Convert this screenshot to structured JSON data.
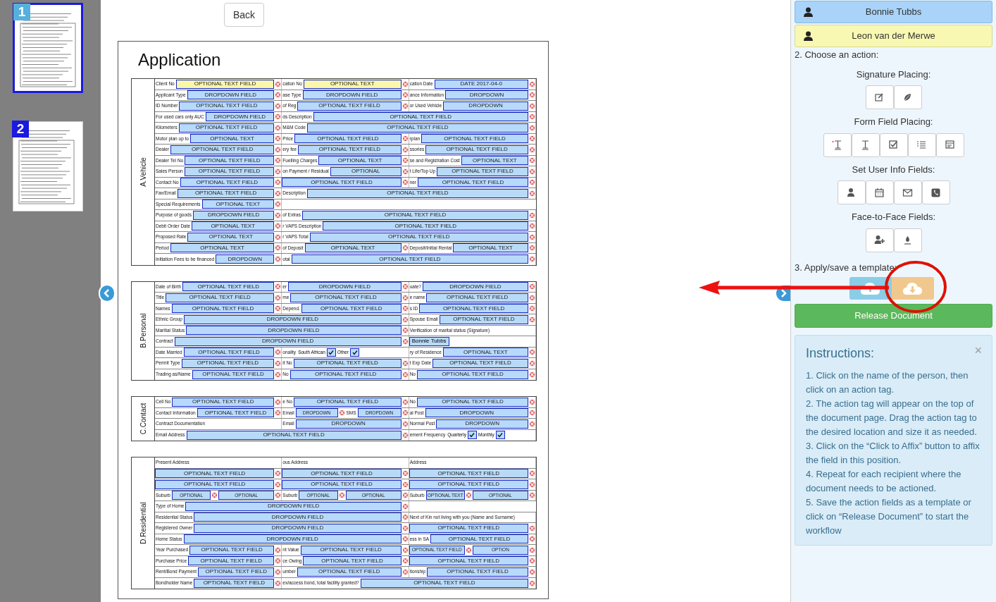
{
  "pages": [
    {
      "number": "1",
      "selected": true
    },
    {
      "number": "2",
      "selected": false
    }
  ],
  "back_button": "Back",
  "document": {
    "title": "Application",
    "sections": [
      {
        "title": "A.Vehicle",
        "rows": [
          [
            {
              "kind": "field",
              "label": "Client No",
              "field": "OPTIONAL TEXT FIELD",
              "required": true
            },
            {
              "kind": "field",
              "label": "cation No",
              "field": "OPTIONAL TEXT",
              "required": true
            },
            {
              "kind": "field",
              "label": "cation Date",
              "field": "DATE 2017-04-0",
              "required": false
            }
          ],
          [
            {
              "kind": "field",
              "label": "Applicant Type",
              "field": "DROPDOWN FIELD",
              "required": false
            },
            {
              "kind": "field",
              "label": "ase Type",
              "field": "DROPDOWN FIELD",
              "required": false
            },
            {
              "kind": "field",
              "label": "ance Information",
              "field": "DROPDOWN",
              "required": false
            }
          ],
          [
            {
              "kind": "field",
              "label": "ID Number",
              "field": "OPTIONAL TEXT FIELD",
              "required": false
            },
            {
              "kind": "field",
              "label": "of Reg",
              "field": "OPTIONAL TEXT FIELD",
              "required": false
            },
            {
              "kind": "field",
              "label": "or Used Vehicle",
              "field": "DROPDOWN",
              "required": false
            }
          ],
          [
            {
              "kind": "field",
              "label": "For used cars only AUC",
              "field": "DROPDOWN FIELD",
              "required": false
            },
            {
              "kind": "field",
              "label": "ds Description",
              "field": "OPTIONAL TEXT FIELD",
              "required": false
            },
            ""
          ],
          [
            {
              "kind": "field",
              "label": "Kilometers",
              "field": "OPTIONAL TEXT FIELD",
              "required": false
            },
            {
              "kind": "field",
              "label": "M&M Code",
              "field": "OPTIONAL TEXT FIELD",
              "required": false
            },
            ""
          ],
          [
            {
              "kind": "field",
              "label": "Motor plan up to",
              "field": "OPTIONAL TEXT",
              "required": false
            },
            {
              "kind": "field",
              "label": "Price",
              "field": "OPTIONAL TEXT FIELD",
              "required": false
            },
            {
              "kind": "field",
              "label": "rplan",
              "field": "OPTIONAL TEXT FIELD",
              "required": false
            }
          ],
          [
            {
              "kind": "field",
              "label": "Dealer",
              "field": "OPTIONAL TEXT FIELD",
              "required": false
            },
            {
              "kind": "field",
              "label": "ery fee",
              "field": "OPTIONAL TEXT FIELD",
              "required": false
            },
            {
              "kind": "field",
              "label": "ssories",
              "field": "OPTIONAL TEXT FIELD",
              "required": false
            }
          ],
          [
            {
              "kind": "field",
              "label": "Dealer Tel No",
              "field": "OPTIONAL TEXT FIELD",
              "required": false
            },
            {
              "kind": "field",
              "label": "Fuelling Charges",
              "field": "OPTIONAL TEXT",
              "required": false
            },
            {
              "kind": "field",
              "label": "se and Registration Cost",
              "field": "OPTIONAL TEXT",
              "required": false
            }
          ],
          [
            {
              "kind": "field",
              "label": "Sales Person",
              "field": "OPTIONAL TEXT FIELD",
              "required": false
            },
            {
              "kind": "field",
              "label": "on Payment / Residual",
              "field": "OPTIONAL",
              "required": false
            },
            {
              "kind": "field",
              "label": "t Life/Top Up",
              "field": "OPTIONAL TEXT FIELD",
              "required": false
            }
          ],
          [
            {
              "kind": "field",
              "label": "Contact No",
              "field": "OPTIONAL TEXT FIELD",
              "required": false
            },
            {
              "kind": "field",
              "field": "OPTIONAL TEXT FIELD",
              "required": false
            },
            {
              "kind": "field",
              "label": "ner",
              "field": "OPTIONAL TEXT FIELD",
              "required": false
            }
          ],
          [
            {
              "kind": "field",
              "label": "Fax/Email",
              "field": "OPTIONAL TEXT FIELD",
              "required": false
            },
            {
              "kind": "field",
              "label": "Description",
              "field": "OPTIONAL TEXT FIELD",
              "required": false
            },
            ""
          ],
          [
            {
              "kind": "field",
              "label": "Special Requirements",
              "field": "OPTIONAL TEXT",
              "required": false
            }
          ],
          [
            {
              "kind": "field",
              "label": "Purpose of goods",
              "field": "DROPDOWN FIELD",
              "required": false
            },
            {
              "kind": "field",
              "label": "of Extras",
              "field": "OPTIONAL TEXT FIELD",
              "required": false
            },
            ""
          ],
          [
            {
              "kind": "field",
              "label": "Debit Order Date",
              "field": "OPTIONAL TEXT",
              "required": false
            },
            {
              "kind": "field",
              "label": "r VAPS Description",
              "field": "OPTIONAL TEXT FIELD",
              "required": false
            },
            ""
          ],
          [
            {
              "kind": "field",
              "label": "Proposed Rate",
              "field": "OPTIONAL TEXT",
              "required": false
            },
            {
              "kind": "field",
              "label": "r VAPS Total",
              "field": "OPTIONAL TEXT FIELD",
              "required": false
            },
            ""
          ],
          [
            {
              "kind": "field",
              "label": "Period",
              "field": "OPTIONAL TEXT",
              "required": false
            },
            {
              "kind": "field",
              "label": "of Deposit",
              "field": "OPTIONAL TEXT",
              "required": false
            },
            {
              "kind": "field",
              "label": "Deposit/Initial Rental",
              "field": "OPTIONAL TEXT",
              "required": false
            }
          ],
          [
            {
              "kind": "field",
              "label": "Initiation Fees to be financed",
              "field": "DROPDOWN",
              "required": false
            },
            {
              "kind": "field",
              "label": "otal",
              "field": "OPTIONAL TEXT FIELD",
              "required": false
            },
            ""
          ]
        ]
      },
      {
        "title": "B.Personal",
        "rows": [
          [
            {
              "kind": "field",
              "label": "Date of Birth",
              "field": "OPTIONAL TEXT FIELD",
              "required": false
            },
            {
              "kind": "field",
              "label": "er",
              "field": "DROPDOWN FIELD",
              "required": false
            },
            {
              "kind": "field",
              "label": "uate?",
              "field": "DROPDOWN FIELD",
              "required": false
            }
          ],
          [
            {
              "kind": "field",
              "label": "Title",
              "field": "OPTIONAL TEXT FIELD",
              "required": false
            },
            {
              "kind": "field",
              "label": "me",
              "field": "OPTIONAL TEXT FIELD",
              "required": false
            },
            {
              "kind": "field",
              "label": "e name",
              "field": "OPTIONAL TEXT FIELD",
              "required": false
            }
          ],
          [
            {
              "kind": "field",
              "label": "Names",
              "field": "OPTIONAL TEXT FIELD",
              "required": false
            },
            {
              "kind": "field",
              "label": "Depend.",
              "field": "OPTIONAL TEXT FIELD",
              "required": false
            },
            {
              "kind": "field",
              "label": "s ID",
              "field": "OPTIONAL TEXT FIELD",
              "required": false
            }
          ],
          [
            {
              "kind": "field",
              "label": "Ethnic Group",
              "field": "DROPDOWN FIELD",
              "required": false
            },
            "",
            {
              "kind": "field",
              "label": "Spouse Email",
              "field": "OPTIONAL TEXT FIELD",
              "required": false
            }
          ],
          [
            {
              "kind": "field",
              "label": "Maritial Status",
              "field": "DROPDOWN FIELD",
              "required": false
            },
            "",
            {
              "kind": "label",
              "label": "Verification of marital status (Signature)"
            }
          ],
          [
            {
              "kind": "field",
              "label": "Contract",
              "field": "DROPDOWN FIELD",
              "required": false
            },
            "",
            {
              "kind": "signature",
              "field": "Bonnie Tubbs"
            }
          ],
          [
            {
              "kind": "field",
              "label": "Date Married",
              "field": "OPTIONAL TEXT FIELD",
              "required": false
            },
            {
              "kind": "checks",
              "label": "onality",
              "options": [
                {
                  "label": "South African",
                  "checked": true
                },
                {
                  "label": "Other",
                  "checked": true
                }
              ]
            },
            {
              "kind": "field",
              "label": "ry of Residence",
              "field": "OPTIONAL TEXT",
              "required": false
            }
          ],
          [
            {
              "kind": "field",
              "label": "Permit Type",
              "field": "OPTIONAL TEXT FIELD",
              "required": false
            },
            {
              "kind": "field",
              "label": "it No",
              "field": "OPTIONAL TEXT FIELD",
              "required": false
            },
            {
              "kind": "field",
              "label": "t Exp Date",
              "field": "OPTIONAL TEXT FIELD",
              "required": false
            }
          ],
          [
            {
              "kind": "field",
              "label": "Trading as/Name",
              "field": "OPTIONAL TEXT FIELD",
              "required": false
            },
            {
              "kind": "field",
              "label": "No",
              "field": "OPTIONAL TEXT FIELD",
              "required": false
            },
            {
              "kind": "field",
              "label": "No",
              "field": "OPTIONAL TEXT FIELD",
              "required": false
            }
          ]
        ]
      },
      {
        "title": "C.Contact",
        "rows": [
          [
            {
              "kind": "field",
              "label": "Cell No",
              "field": "OPTIONAL TEXT FIELD",
              "required": false
            },
            {
              "kind": "field",
              "label": "e No",
              "field": "OPTIONAL TEXT FIELD",
              "required": false
            },
            {
              "kind": "field",
              "label": "No",
              "field": "OPTIONAL TEXT FIELD",
              "required": false
            }
          ],
          [
            {
              "kind": "field",
              "label": "Contact Information",
              "field": "OPTIONAL TEXT FIELD",
              "required": false
            },
            {
              "kind": "pair",
              "parts": [
                {
                  "kind": "field",
                  "label": "Email",
                  "field": "DROPDOWN",
                  "required": false
                },
                {
                  "kind": "field",
                  "label": "SMS",
                  "field": "DROPDOWN",
                  "required": false
                }
              ]
            },
            {
              "kind": "field",
              "label": "al Post",
              "field": "DROPDOWN",
              "required": false
            }
          ],
          [
            {
              "kind": "label",
              "label": "Contract Documentation"
            },
            {
              "kind": "field",
              "label": "Email",
              "field": "DROPDOWN",
              "required": false
            },
            {
              "kind": "field",
              "label": "Normal Post",
              "field": "DROPDOWN",
              "required": false
            }
          ],
          [
            {
              "kind": "field",
              "label": "Email Address",
              "field": "OPTIONAL TEXT FIELD",
              "required": false
            },
            "",
            {
              "kind": "checks",
              "label": "ement Frequency",
              "options": [
                {
                  "label": "Quarterly",
                  "checked": true
                },
                {
                  "label": "Monthly",
                  "checked": true
                }
              ]
            }
          ]
        ]
      },
      {
        "title": "D.Residential",
        "rows": [
          [
            {
              "kind": "label",
              "label": "Present Address"
            },
            {
              "kind": "label",
              "label": "ous Address"
            },
            {
              "kind": "label",
              "label": "Address"
            }
          ],
          [
            {
              "kind": "field",
              "field": "OPTIONAL TEXT FIELD",
              "required": false
            },
            {
              "kind": "field",
              "field": "OPTIONAL TEXT FIELD",
              "required": false
            },
            {
              "kind": "field",
              "field": "OPTIONAL TEXT FIELD",
              "required": false
            }
          ],
          [
            {
              "kind": "field",
              "field": "OPTIONAL TEXT FIELD",
              "required": false
            },
            {
              "kind": "field",
              "field": "OPTIONAL TEXT FIELD",
              "required": false
            },
            {
              "kind": "field",
              "field": "OPTIONAL TEXT FIELD",
              "required": false
            }
          ],
          [
            {
              "kind": "pair",
              "parts": [
                {
                  "kind": "field",
                  "label": "Suburb",
                  "field": "OPTIONAL",
                  "required": false
                },
                {
                  "kind": "field",
                  "field": "OPTIONAL",
                  "required": false
                }
              ]
            },
            {
              "kind": "pair",
              "parts": [
                {
                  "kind": "field",
                  "label": "Suburb",
                  "field": "OPTIONAL",
                  "required": false
                },
                {
                  "kind": "field",
                  "field": "OPTIONAL",
                  "required": false
                }
              ]
            },
            {
              "kind": "pair",
              "parts": [
                {
                  "kind": "field",
                  "label": "Suburb",
                  "field": "OPTIONAL TEXT",
                  "required": false
                },
                {
                  "kind": "field",
                  "field": "OPTIONAL",
                  "required": false
                }
              ]
            }
          ],
          [
            {
              "kind": "field",
              "label": "Type of Home",
              "field": "DROPDOWN FIELD",
              "required": false
            },
            ""
          ],
          [
            {
              "kind": "field",
              "label": "Residential Status",
              "field": "DROPDOWN FIELD",
              "required": false
            },
            "",
            {
              "kind": "label",
              "label": "Next of Kin not living with you (Name and Surname)"
            }
          ],
          [
            {
              "kind": "field",
              "label": "Registered Owner",
              "field": "DROPDOWN FIELD",
              "required": false
            },
            "",
            {
              "kind": "field",
              "field": "OPTIONAL TEXT FIELD",
              "required": false
            }
          ],
          [
            {
              "kind": "field",
              "label": "Home Status",
              "field": "DROPDOWN FIELD",
              "required": false
            },
            "",
            {
              "kind": "field",
              "label": "ess in SA",
              "field": "OPTIONAL TEXT FIELD",
              "required": false
            }
          ],
          [
            {
              "kind": "field",
              "label": "Year Purchased",
              "field": "OPTIONAL TEXT FIELD",
              "required": false
            },
            {
              "kind": "field",
              "label": "nt Value",
              "field": "OPTIONAL TEXT FIELD",
              "required": false
            },
            {
              "kind": "pair",
              "parts": [
                {
                  "kind": "field",
                  "field": "OPTIONAL TEXT FIELD",
                  "required": false
                },
                {
                  "kind": "field",
                  "field": "OPTION",
                  "required": false
                }
              ]
            }
          ],
          [
            {
              "kind": "field",
              "label": "Purchase Price",
              "field": "OPTIONAL TEXT FIELD",
              "required": false
            },
            {
              "kind": "field",
              "label": "ce Owing",
              "field": "OPTIONAL TEXT FIELD",
              "required": false
            },
            {
              "kind": "field",
              "field": "OPTIONAL TEXT FIELD",
              "required": false
            }
          ],
          [
            {
              "kind": "field",
              "label": "Rent/Bond Payment",
              "field": "OPTIONAL TEXT FIELD",
              "required": false
            },
            {
              "kind": "field",
              "label": "umber",
              "field": "OPTIONAL TEXT FIELD",
              "required": false
            },
            {
              "kind": "field",
              "label": "tionship",
              "field": "OPTIONAL TEXT FIELD",
              "required": false
            }
          ],
          [
            {
              "kind": "field",
              "label": "Bondholder Name",
              "field": "OPTIONAL TEXT FIELD",
              "required": false
            },
            {
              "kind": "field",
              "label": "ex/access bond, total facility granted?",
              "field": "OPTIONAL TEXT FIELD",
              "required": false
            },
            ""
          ]
        ]
      }
    ]
  },
  "panel": {
    "recipients": [
      {
        "name": "Bonnie Tubbs",
        "color": "#a9d3f8",
        "selected": true
      },
      {
        "name": "Leon van der Merwe",
        "color": "#f8f8b2",
        "selected": false
      }
    ],
    "step_2": "2. Choose an action:",
    "groups": [
      {
        "title": "Signature Placing:",
        "tools": [
          {
            "kind": "edit"
          },
          {
            "kind": "leaf"
          }
        ]
      },
      {
        "title": "Form Field Placing:",
        "tools": [
          {
            "kind": "required-text"
          },
          {
            "kind": "text"
          },
          {
            "kind": "checkbox"
          },
          {
            "kind": "list"
          },
          {
            "kind": "form"
          }
        ]
      },
      {
        "title": "Set User Info Fields:",
        "tools": [
          {
            "kind": "user"
          },
          {
            "kind": "calendar"
          },
          {
            "kind": "mail"
          },
          {
            "kind": "phone"
          }
        ]
      },
      {
        "title": "Face-to-Face Fields:",
        "tools": [
          {
            "kind": "add-user"
          },
          {
            "kind": "ink"
          }
        ]
      }
    ],
    "step_3": "3. Apply/save a template:",
    "release_button": "Release Document",
    "instructions": {
      "title": "Instructions:",
      "close": "×",
      "items": [
        "1. Click on the name of the person, then click on an action tag.",
        "2. The action tag will appear on the top of the document page. Drag the action tag to the desired location and size it as needed.",
        "3. Click on the “Click to Affix” button to affix the field in this position.",
        "4. Repeat for each recipient where the document needs to be actioned.",
        "5. Save the action fields as a template or click on “Release Document” to start the workflow"
      ]
    }
  }
}
